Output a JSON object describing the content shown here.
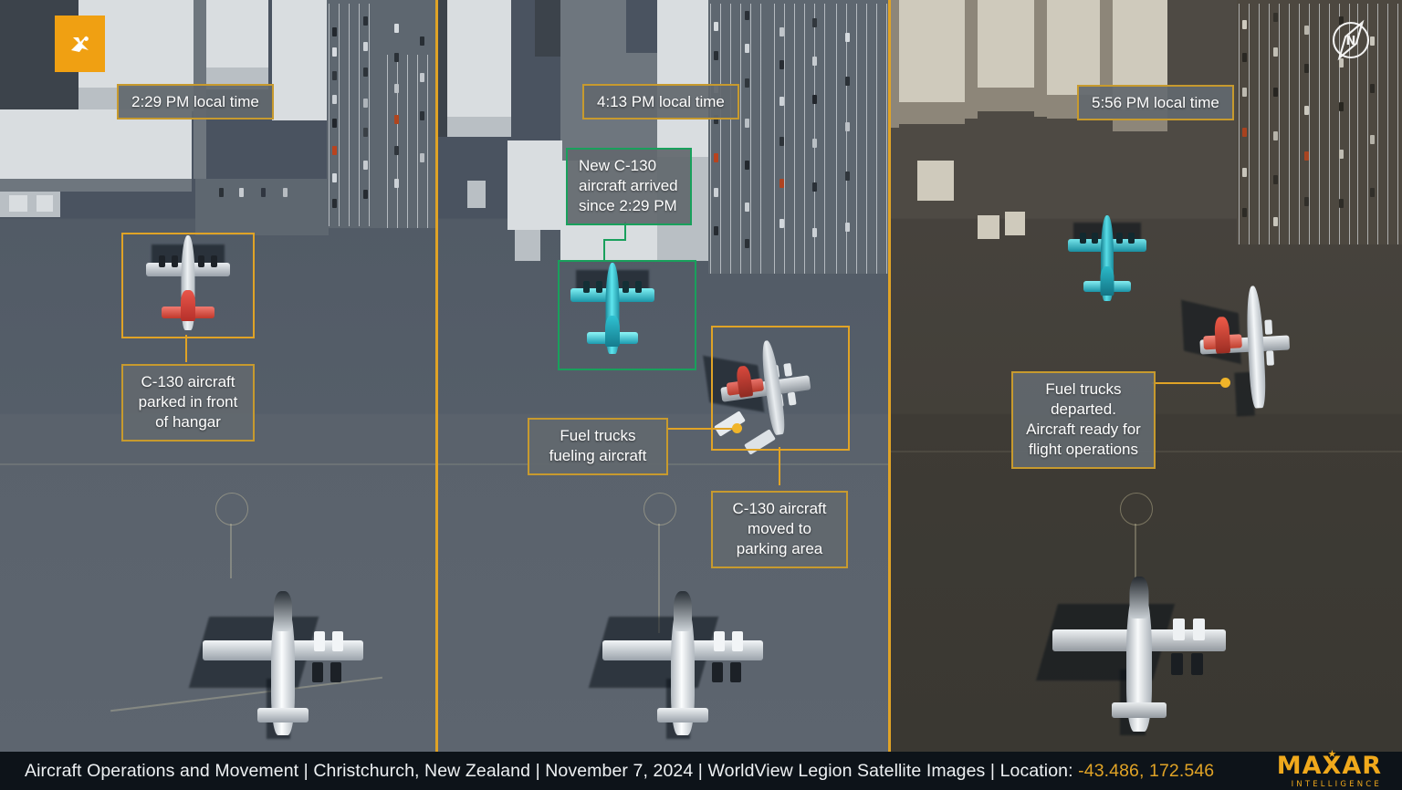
{
  "caption": {
    "text_before": "Aircraft Operations and Movement | Christchurch, New Zealand | November 7, 2024 | WorldView Legion Satellite Images | Location: ",
    "coordinates": "-43.486, 172.546",
    "title": "Aircraft Operations and Movement",
    "location_name": "Christchurch, New Zealand",
    "date": "November 7, 2024",
    "source": "WorldView Legion Satellite Images",
    "location_label": "Location:"
  },
  "brand": {
    "name": "MAXAR",
    "tagline": "INTELLIGENCE",
    "badge_icon": "maxar-star-icon",
    "logo_color": "#f0a91c",
    "badge_color": "#f0a012"
  },
  "compass": {
    "icon": "north-compass-icon",
    "label": "N"
  },
  "colors": {
    "accent_orange": "#e0a326",
    "accent_green": "#19a05c",
    "highlight_cyan": "#35e0e0",
    "highlight_red": "#e8483c",
    "marker_dot": "#f0b429",
    "callout_bg": "rgba(98,104,110,0.93)"
  },
  "panels": [
    {
      "id": "panel-1",
      "time_label": "2:29 PM local time",
      "callouts": [
        {
          "name": "callout-c130-parked",
          "text": "C-130 aircraft\nparked in front\nof hangar",
          "border": "orange"
        }
      ],
      "highlight_boxes": [
        {
          "name": "highlight-box-c130-parked",
          "border": "orange"
        }
      ]
    },
    {
      "id": "panel-2",
      "time_label": "4:13 PM local time",
      "callouts": [
        {
          "name": "callout-new-c130-arrived",
          "text": "New C-130\naircraft arrived\nsince 2:29 PM",
          "border": "green"
        },
        {
          "name": "callout-fuel-trucks-fueling",
          "text": "Fuel trucks\nfueling aircraft",
          "border": "orange"
        },
        {
          "name": "callout-c130-moved-parking",
          "text": "C-130 aircraft\nmoved to\nparking area",
          "border": "orange"
        }
      ],
      "highlight_boxes": [
        {
          "name": "highlight-box-new-c130",
          "border": "green"
        },
        {
          "name": "highlight-box-fueling-aircraft",
          "border": "orange"
        }
      ]
    },
    {
      "id": "panel-3",
      "time_label": "5:56 PM local time",
      "callouts": [
        {
          "name": "callout-fuel-trucks-departed",
          "text": "Fuel trucks\ndeparted.\nAircraft ready for\nflight operations",
          "border": "orange"
        }
      ],
      "highlight_boxes": []
    }
  ]
}
